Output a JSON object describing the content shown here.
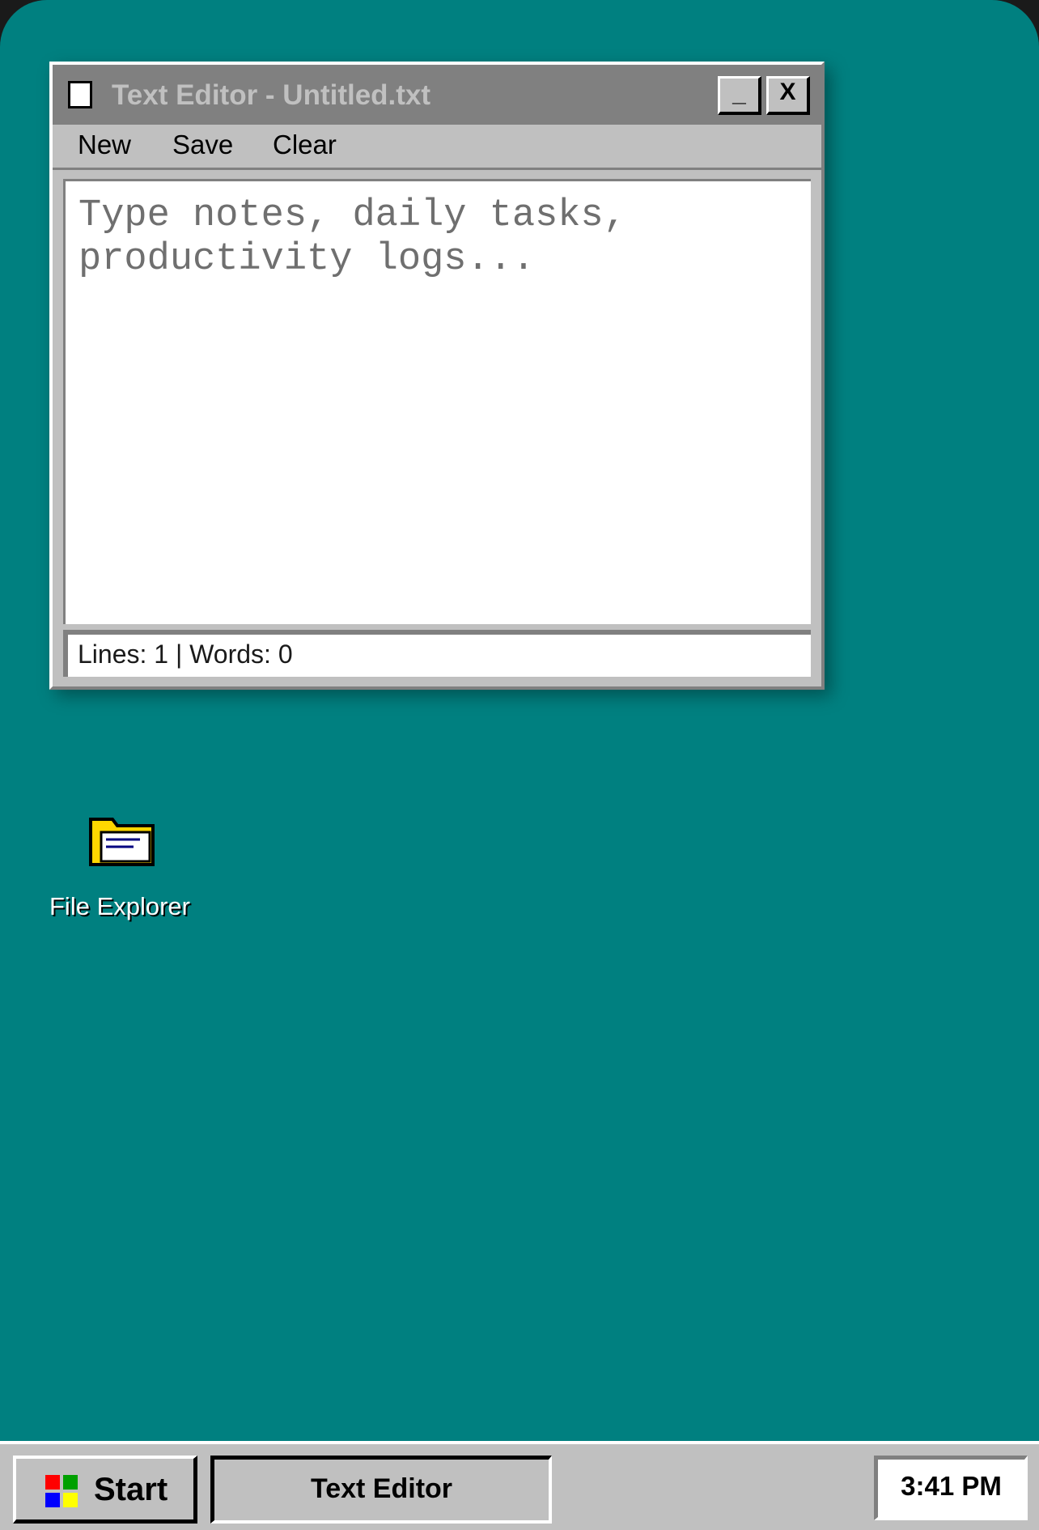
{
  "window": {
    "title": "Text Editor - Untitled.txt",
    "minimize_label": "_",
    "close_label": "X",
    "menu": {
      "new_label": "New",
      "save_label": "Save",
      "clear_label": "Clear"
    },
    "editor": {
      "value": "",
      "placeholder": "Type notes, daily tasks, productivity logs..."
    },
    "status": "Lines: 1 | Words: 0"
  },
  "desktop": {
    "icons": [
      {
        "label": "File Explorer",
        "icon": "folder-icon"
      }
    ]
  },
  "taskbar": {
    "start_label": "Start",
    "tasks": [
      {
        "label": "Text Editor"
      }
    ],
    "clock": "3:41 PM"
  },
  "colors": {
    "desktop": "#008080",
    "chrome": "#c0c0c0",
    "titlebar": "#808080",
    "folder": "#ffd700",
    "logo_red": "#ff0000",
    "logo_green": "#00a000",
    "logo_blue": "#0000ff",
    "logo_yellow": "#ffff00"
  }
}
